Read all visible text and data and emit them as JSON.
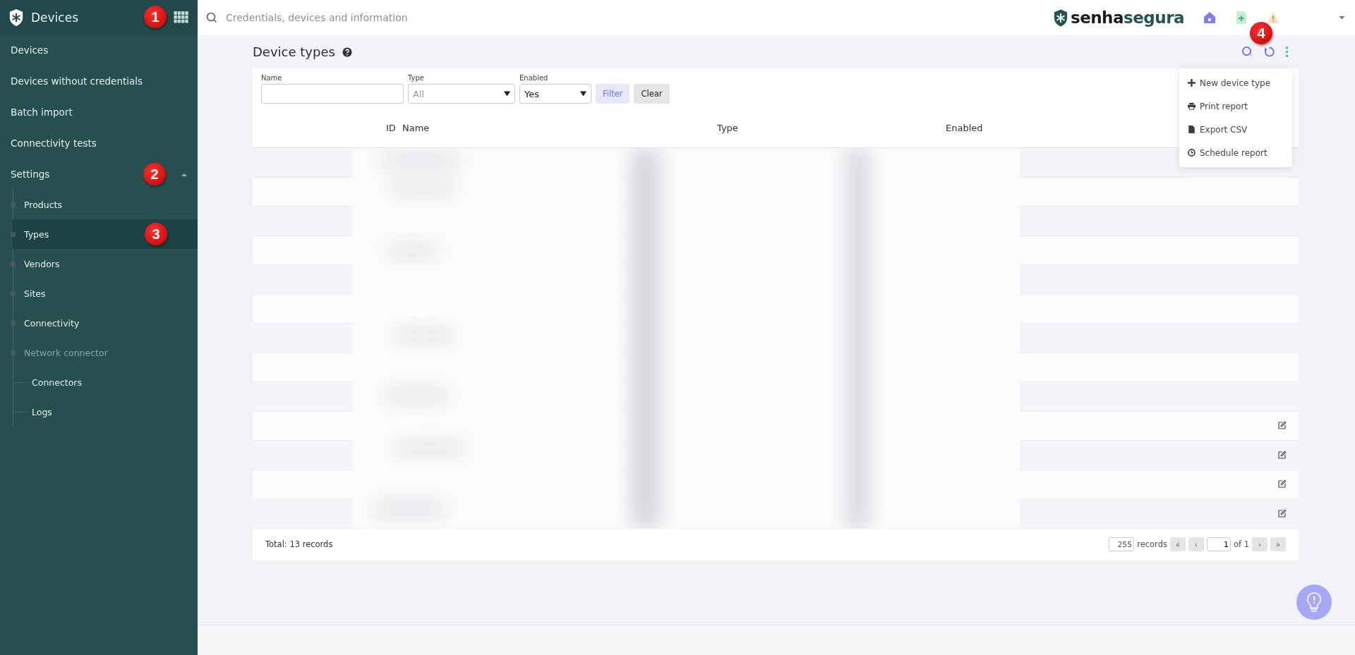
{
  "sidebar": {
    "title": "Devices",
    "items": [
      {
        "label": "Devices",
        "selected": false
      },
      {
        "label": "Devices without credentials",
        "selected": false
      },
      {
        "label": "Batch import",
        "selected": false
      },
      {
        "label": "Connectivity tests",
        "selected": false
      },
      {
        "label": "Settings",
        "selected": false,
        "expanded": true,
        "children": [
          {
            "label": "Products",
            "selected": false,
            "disabled": false
          },
          {
            "label": "Types",
            "selected": true,
            "disabled": false
          },
          {
            "label": "Vendors",
            "selected": false,
            "disabled": false
          },
          {
            "label": "Sites",
            "selected": false,
            "disabled": false
          },
          {
            "label": "Connectivity",
            "selected": false,
            "disabled": false
          },
          {
            "label": "Network connector",
            "selected": false,
            "disabled": true,
            "children": [
              {
                "label": "Connectors",
                "selected": false
              },
              {
                "label": "Logs",
                "selected": false
              }
            ]
          }
        ]
      }
    ]
  },
  "topbar": {
    "search": {
      "placeholder": "Credentials, devices and information"
    },
    "brand": {
      "first": "senha",
      "second": "segura"
    }
  },
  "page": {
    "title": "Device types",
    "filters": [
      {
        "label": "Name",
        "kind": "text"
      },
      {
        "label": "Type",
        "kind": "select",
        "placeholder": "All"
      },
      {
        "label": "Enabled",
        "kind": "select",
        "value": "Yes"
      }
    ],
    "buttons": [
      {
        "label": "Filter",
        "kind": "primary"
      },
      {
        "label": "Clear",
        "kind": "plain"
      }
    ],
    "columns": [
      "ID",
      "Name",
      "Type",
      "Enabled"
    ],
    "rows": [
      {},
      {},
      {},
      {
        "editable": false
      },
      {
        "editable": false
      },
      {
        "editable": false
      },
      {
        "editable": false
      },
      {
        "editable": false
      },
      {
        "editable": false
      },
      {
        "editable": true
      },
      {
        "editable": true
      },
      {
        "editable": true
      },
      {
        "editable": true
      }
    ],
    "total": "Total: 13 records",
    "pagination": {
      "page_size": "255",
      "records_label": "records",
      "first": "«",
      "prev": "‹",
      "page": "1",
      "of": "of 1",
      "next": "›",
      "last": "»"
    },
    "menu": [
      {
        "label": "New device type"
      },
      {
        "label": "Print report"
      },
      {
        "label": "Export CSV"
      },
      {
        "label": "Schedule report"
      }
    ]
  },
  "callouts": [
    "1",
    "2",
    "3",
    "4"
  ]
}
